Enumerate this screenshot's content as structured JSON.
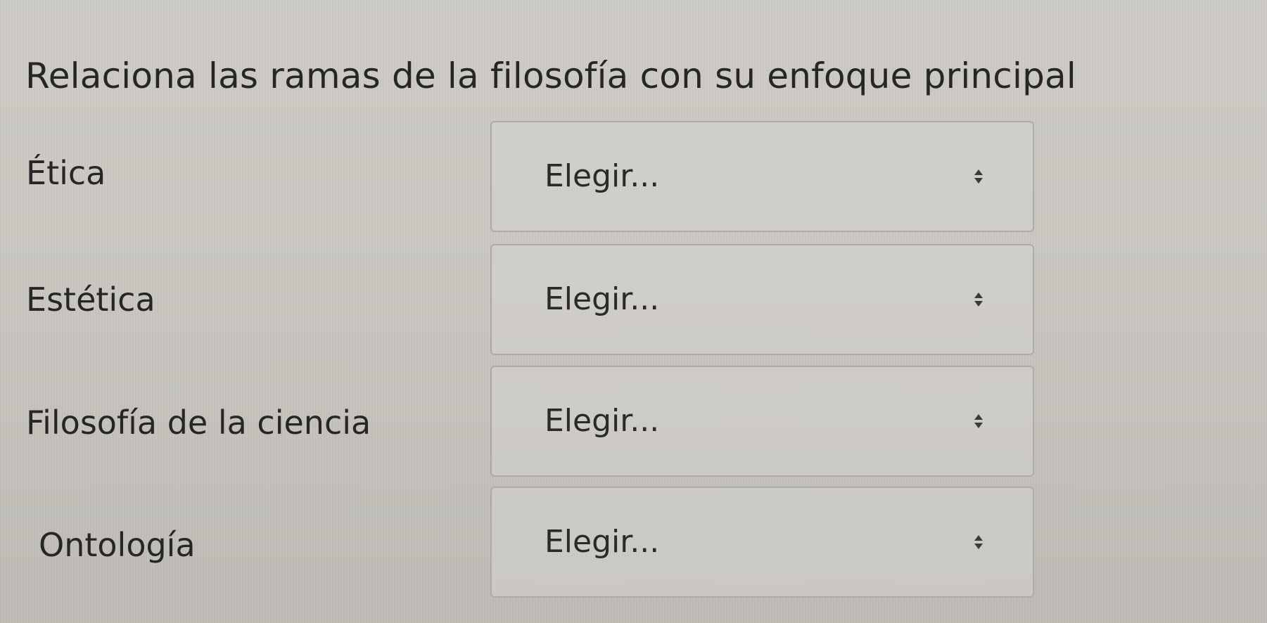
{
  "question": {
    "title": "Relaciona las ramas de la filosofía con su enfoque principal"
  },
  "rows": [
    {
      "label": "Ética",
      "selected": "Elegir..."
    },
    {
      "label": "Estética",
      "selected": "Elegir..."
    },
    {
      "label": "Filosofía de la ciencia",
      "selected": "Elegir..."
    },
    {
      "label": "Ontología",
      "selected": "Elegir..."
    }
  ],
  "icons": {
    "select_caret": "chevron-up-down-icon"
  },
  "colors": {
    "text": "#262626",
    "select_border": "#aeaba5",
    "background": "#c9c6c0"
  }
}
